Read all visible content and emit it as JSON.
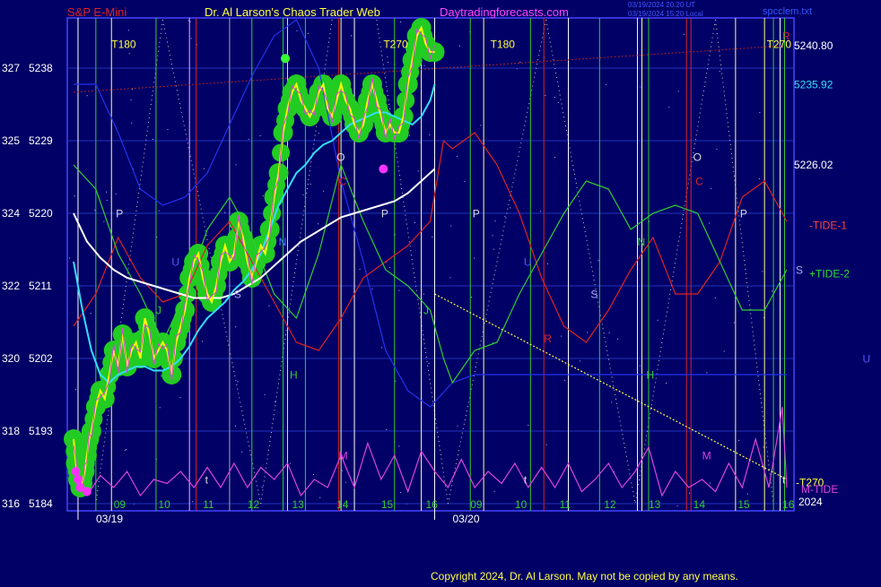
{
  "header": {
    "symbol": "S&P E-Mini",
    "site_title": "Dr. Al Larson's Chaos Trader Web",
    "site_url": "Daytradingforecasts.com",
    "stamp_line1": "03/19/2024 20:20 UT",
    "stamp_line2": "03/19/2024 15:20 Local",
    "file_name": "spcclem.txt"
  },
  "footer": {
    "copyright": "Copyright 2024, Dr. Al Larson. May not be copied by any means."
  },
  "colors": {
    "background": "#000066",
    "plot_border": "#4444ff",
    "price_line": "#ffff00",
    "price_halo": "#22cc22",
    "ema_fast": "#33ddff",
    "ema_slow": "#ffffff",
    "tide1": "#dd2222",
    "tide2": "#33cc33",
    "mtide": "#dd44dd",
    "blue_line": "#2233ee",
    "t270_line": "#ffff44",
    "red_trend": "#aa2222"
  },
  "chart_data": {
    "type": "line",
    "title": "S&P E-Mini",
    "xlabel": "",
    "ylabel": "",
    "x_range": [
      0,
      16
    ],
    "ylim": [
      5184,
      5244
    ],
    "grid": false,
    "dates": [
      "03/19",
      "03/20"
    ],
    "x_tick_labels": [
      "09",
      "10",
      "11",
      "12",
      "13",
      "14",
      "15",
      "16",
      "09",
      "10",
      "11",
      "12",
      "13",
      "14",
      "15",
      "16"
    ],
    "x_tick_positions": [
      0.9,
      1.9,
      2.9,
      3.9,
      4.9,
      5.9,
      6.9,
      7.9,
      8.9,
      9.9,
      10.9,
      11.9,
      12.9,
      13.9,
      14.9,
      15.9
    ],
    "y_axis_labels": [
      {
        "deg": "316",
        "price": "5184",
        "value": 5184
      },
      {
        "deg": "318",
        "price": "5193",
        "value": 5193
      },
      {
        "deg": "320",
        "price": "5202",
        "value": 5202
      },
      {
        "deg": "322",
        "price": "5211",
        "value": 5211
      },
      {
        "deg": "324",
        "price": "5220",
        "value": 5220
      },
      {
        "deg": "325",
        "price": "5229",
        "value": 5229
      },
      {
        "deg": "327",
        "price": "5238",
        "value": 5238
      }
    ],
    "right_labels": [
      {
        "text": "5240.80",
        "value": 5240.8,
        "color": "#ffffff"
      },
      {
        "text": "5235.92",
        "value": 5235.92,
        "color": "#33ddff"
      },
      {
        "text": "5226.02",
        "value": 5226.02,
        "color": "#ffffff"
      },
      {
        "text": "-TIDE-1",
        "value": 5218.5,
        "color": "#ff4444"
      },
      {
        "text": "+TIDE-2",
        "value": 5212.5,
        "color": "#33dd33"
      },
      {
        "text": "-T270",
        "value": 5186.6,
        "color": "#ffff44"
      },
      {
        "text": "M-TIDE",
        "value": 5185.8,
        "color": "#dd44dd"
      },
      {
        "text": "2024",
        "value": 5184.2,
        "color": "#ffffff"
      }
    ],
    "series": [
      {
        "name": "",
        "color": "#ffff00",
        "x": [
          0,
          0.05,
          0.1,
          0.15,
          0.2,
          0.25,
          0.3,
          0.35,
          0.4,
          0.5,
          0.6,
          0.7,
          0.8,
          0.9,
          1.0,
          1.1,
          1.2,
          1.3,
          1.4,
          1.5,
          1.6,
          1.7,
          1.8,
          1.9,
          2.0,
          2.1,
          2.2,
          2.3,
          2.4,
          2.5,
          2.6,
          2.7,
          2.8,
          2.9,
          3.0,
          3.1,
          3.2,
          3.3,
          3.4,
          3.5,
          3.6,
          3.7,
          3.8,
          3.9,
          4.0,
          4.1,
          4.2,
          4.3,
          4.4,
          4.5,
          4.6,
          4.7,
          4.8,
          4.9,
          5.0,
          5.1,
          5.2,
          5.3,
          5.4,
          5.5,
          5.6,
          5.7,
          5.8,
          5.9,
          6.0,
          6.1,
          6.2,
          6.3,
          6.4,
          6.5,
          6.6,
          6.7,
          6.8,
          6.9,
          7.0,
          7.1,
          7.2,
          7.3,
          7.4,
          7.5,
          7.6,
          7.7,
          7.8,
          7.9,
          8.0,
          8.1
        ],
        "values": [
          5192,
          5189,
          5187,
          5186,
          5186.5,
          5188,
          5190,
          5192,
          5193,
          5196,
          5198,
          5197,
          5200,
          5203,
          5201,
          5205,
          5201,
          5203,
          5204,
          5202,
          5207,
          5205,
          5202,
          5203,
          5204,
          5203,
          5200,
          5204,
          5206,
          5208,
          5212,
          5214,
          5215,
          5212,
          5210,
          5209,
          5211,
          5214,
          5216,
          5214,
          5215,
          5219,
          5217,
          5214,
          5212,
          5214,
          5216,
          5215,
          5218,
          5222,
          5225,
          5230,
          5233,
          5235,
          5236,
          5234,
          5233,
          5232,
          5233,
          5235,
          5236,
          5233,
          5232,
          5234,
          5236,
          5234,
          5233,
          5231,
          5230,
          5231,
          5234,
          5236,
          5234,
          5232,
          5230,
          5231,
          5230,
          5230,
          5232,
          5236,
          5239,
          5242,
          5243,
          5241,
          5240,
          5240
        ]
      },
      {
        "name": "",
        "color": "#33ddff",
        "x": [
          0,
          0.2,
          0.4,
          0.6,
          0.8,
          1.0,
          1.2,
          1.4,
          1.6,
          1.8,
          2.0,
          2.2,
          2.4,
          2.6,
          2.8,
          3.0,
          3.2,
          3.4,
          3.6,
          3.8,
          4.0,
          4.2,
          4.4,
          4.6,
          4.8,
          5.0,
          5.2,
          5.4,
          5.6,
          5.8,
          6.0,
          6.2,
          6.4,
          6.6,
          6.8,
          7.0,
          7.2,
          7.4,
          7.6,
          7.8,
          8.0,
          8.1
        ],
        "values": [
          5214,
          5208,
          5203,
          5200,
          5199,
          5200,
          5200.5,
          5201,
          5201,
          5200.5,
          5200.5,
          5201,
          5202,
          5203.5,
          5205.5,
          5207,
          5208,
          5209,
          5210.5,
          5211.5,
          5213,
          5215,
          5218,
          5221,
          5223,
          5225,
          5226,
          5227.5,
          5228.5,
          5229,
          5230,
          5231,
          5231.5,
          5232,
          5232.5,
          5232.5,
          5232,
          5231.5,
          5231,
          5232,
          5234,
          5236
        ]
      },
      {
        "name": "",
        "color": "#ffffff",
        "x": [
          0,
          0.3,
          0.6,
          0.9,
          1.2,
          1.5,
          1.8,
          2.1,
          2.4,
          2.7,
          3.0,
          3.3,
          3.6,
          3.9,
          4.2,
          4.5,
          4.8,
          5.1,
          5.4,
          5.7,
          6.0,
          6.3,
          6.6,
          6.9,
          7.2,
          7.5,
          7.8,
          8.1
        ],
        "values": [
          5220,
          5216.5,
          5214.5,
          5213,
          5212,
          5211.5,
          5211,
          5210.5,
          5210,
          5209.5,
          5209.5,
          5209.5,
          5210,
          5211,
          5212,
          5213.5,
          5215,
          5216.5,
          5217.5,
          5218.5,
          5219.5,
          5220,
          5220.5,
          5221,
          5221.5,
          5222.5,
          5224,
          5225.5
        ]
      },
      {
        "name": "-TIDE-1",
        "color": "#dd2222",
        "x": [
          0,
          0.5,
          1.0,
          1.5,
          2.0,
          2.5,
          3.0,
          3.5,
          4.0,
          4.5,
          5.0,
          5.5,
          6.0,
          6.5,
          7.0,
          7.5,
          8.0,
          8.3,
          8.5,
          9.0,
          9.5,
          10.0,
          10.5,
          11.0,
          11.5,
          12.0,
          12.5,
          13.0,
          13.5,
          14.0,
          14.5,
          15.0,
          15.5,
          16.0
        ],
        "values": [
          5206,
          5210,
          5217,
          5212,
          5209,
          5210,
          5216,
          5219,
          5214,
          5209,
          5204,
          5203,
          5207,
          5212,
          5214,
          5216,
          5219,
          5229,
          5228,
          5230,
          5226,
          5220,
          5212,
          5206,
          5204,
          5208,
          5213,
          5217,
          5210,
          5210,
          5214,
          5222,
          5224,
          5219
        ]
      },
      {
        "name": "+TIDE-2",
        "color": "#33cc33",
        "x": [
          0,
          0.5,
          1.0,
          1.5,
          2.0,
          2.5,
          3.0,
          3.5,
          4.0,
          4.5,
          5.0,
          5.5,
          6.0,
          6.5,
          7.0,
          7.5,
          8.0,
          8.3,
          8.5,
          9.0,
          9.5,
          10.0,
          10.5,
          11.0,
          11.5,
          12.0,
          12.5,
          13.0,
          13.5,
          14.0,
          14.5,
          15.0,
          15.5,
          16.0
        ],
        "values": [
          5226,
          5223,
          5215,
          5210,
          5204,
          5210,
          5218,
          5222,
          5217,
          5210,
          5207,
          5215,
          5226,
          5219,
          5213,
          5211,
          5208,
          5202,
          5199,
          5203,
          5204,
          5210,
          5215,
          5220,
          5224,
          5223,
          5218,
          5220,
          5221,
          5220,
          5214,
          5208,
          5208,
          5213
        ]
      },
      {
        "name": "",
        "color": "#2233ee",
        "x": [
          0,
          0.5,
          1.0,
          1.5,
          2.0,
          2.5,
          3.0,
          3.5,
          4.0,
          4.5,
          5.0,
          5.5,
          6.0,
          6.5,
          7.0,
          7.5,
          8.0,
          8.5,
          9.0,
          9.5,
          10.0,
          10.5,
          11.0,
          11.5,
          12.0,
          12.5,
          13.0,
          13.5,
          14.0,
          14.5,
          15.0,
          15.5,
          16.0
        ],
        "values": [
          5236,
          5236,
          5230,
          5223,
          5221,
          5222,
          5225,
          5231,
          5237,
          5242,
          5244,
          5238,
          5224,
          5214,
          5203,
          5198,
          5196,
          5199,
          5200,
          5200,
          5200,
          5200,
          5200,
          5200,
          5200,
          5200,
          5200,
          5200,
          5200,
          5200,
          5200,
          5200,
          5200
        ]
      },
      {
        "name": "M-TIDE",
        "color": "#dd44dd",
        "x": [
          0,
          0.3,
          0.6,
          0.9,
          1.2,
          1.5,
          1.8,
          2.1,
          2.4,
          2.7,
          3.0,
          3.3,
          3.6,
          3.9,
          4.2,
          4.5,
          4.8,
          5.1,
          5.4,
          5.7,
          6.0,
          6.3,
          6.6,
          6.9,
          7.2,
          7.5,
          7.8,
          8.1,
          8.4,
          8.7,
          9.0,
          9.3,
          9.6,
          9.9,
          10.2,
          10.5,
          10.8,
          11.1,
          11.4,
          11.7,
          12.0,
          12.3,
          12.6,
          12.9,
          13.2,
          13.5,
          13.8,
          14.1,
          14.4,
          14.7,
          15.0,
          15.3,
          15.6,
          15.9,
          16.0
        ],
        "values": [
          5187,
          5185,
          5187.5,
          5186,
          5188,
          5185,
          5187,
          5186.5,
          5188,
          5186,
          5188.5,
          5186,
          5189,
          5186,
          5188.5,
          5187,
          5189,
          5185,
          5187,
          5186,
          5190,
          5186,
          5191.5,
          5187,
          5190,
          5185.5,
          5190.5,
          5188,
          5186,
          5189.5,
          5186,
          5188,
          5186.5,
          5189,
          5186,
          5188.5,
          5186,
          5189,
          5185.5,
          5187,
          5189,
          5186,
          5188,
          5191,
          5185,
          5188,
          5186,
          5187,
          5185.5,
          5189,
          5186,
          5192,
          5186,
          5196,
          5186
        ]
      },
      {
        "name": "-T270",
        "color": "#ffff44",
        "x": [
          8.1,
          16.0
        ],
        "values": [
          5210,
          5187
        ]
      }
    ]
  },
  "vertical_lines": [
    {
      "x": 0.1,
      "color": "#ffffff"
    },
    {
      "x": 0.5,
      "color": "#33cc33"
    },
    {
      "x": 0.85,
      "color": "#ffff88"
    },
    {
      "x": 1.85,
      "color": "#33cc33"
    },
    {
      "x": 2.6,
      "color": "#ffaaff"
    },
    {
      "x": 2.75,
      "color": "#dd2222"
    },
    {
      "x": 3.5,
      "color": "#aaaaaa"
    },
    {
      "x": 4.0,
      "color": "#33cc33"
    },
    {
      "x": 4.7,
      "color": "#33cc33"
    },
    {
      "x": 4.8,
      "color": "#aaffaa"
    },
    {
      "x": 5.2,
      "color": "#33cc33"
    },
    {
      "x": 5.95,
      "color": "#dd2222"
    },
    {
      "x": 6.0,
      "color": "#ffff88"
    },
    {
      "x": 6.3,
      "color": "#ffffff"
    },
    {
      "x": 7.2,
      "color": "#33cc33"
    },
    {
      "x": 7.8,
      "color": "#ffff88"
    },
    {
      "x": 8.1,
      "color": "#ffffff"
    },
    {
      "x": 8.9,
      "color": "#33cc33"
    },
    {
      "x": 9.2,
      "color": "#ffff88"
    },
    {
      "x": 10.25,
      "color": "#33cc33"
    },
    {
      "x": 10.55,
      "color": "#dd2222"
    },
    {
      "x": 11.1,
      "color": "#ffffff"
    },
    {
      "x": 11.8,
      "color": "#33cc33"
    },
    {
      "x": 12.65,
      "color": "#ffffff"
    },
    {
      "x": 12.75,
      "color": "#ffff88"
    },
    {
      "x": 12.9,
      "color": "#33cc33"
    },
    {
      "x": 13.75,
      "color": "#dd2222"
    },
    {
      "x": 13.85,
      "color": "#dd2222"
    },
    {
      "x": 14.85,
      "color": "#ffff88"
    },
    {
      "x": 15.5,
      "color": "#ffff88"
    },
    {
      "x": 15.7,
      "color": "#33cc33"
    },
    {
      "x": 15.85,
      "color": "#ffffff"
    },
    {
      "x": 15.95,
      "color": "#33cc33"
    }
  ],
  "dotted_diagonals": [
    {
      "x1": 2.0,
      "y1": 5244,
      "x2": 0.5,
      "y2": 5184
    },
    {
      "x1": 2.0,
      "y1": 5244,
      "x2": 4.2,
      "y2": 5184
    },
    {
      "x1": 5.8,
      "y1": 5244,
      "x2": 4.2,
      "y2": 5184
    },
    {
      "x1": 6.8,
      "y1": 5244,
      "x2": 8.4,
      "y2": 5184
    },
    {
      "x1": 10.6,
      "y1": 5244,
      "x2": 8.4,
      "y2": 5184
    },
    {
      "x1": 10.6,
      "y1": 5244,
      "x2": 12.6,
      "y2": 5184
    },
    {
      "x1": 14.4,
      "y1": 5244,
      "x2": 12.6,
      "y2": 5184
    },
    {
      "x1": 14.4,
      "y1": 5244,
      "x2": 15.7,
      "y2": 5184
    }
  ],
  "red_trend": [
    {
      "x": 0,
      "v": 5235
    },
    {
      "x": 16,
      "v": 5240.8
    }
  ],
  "letter_annotations": [
    {
      "text": "T180",
      "x": 0.85,
      "v": 5240.5,
      "color": "#ffff44"
    },
    {
      "text": "T270",
      "x": 6.95,
      "v": 5240.5,
      "color": "#ffff44"
    },
    {
      "text": "T180",
      "x": 9.35,
      "v": 5240.5,
      "color": "#ffff44"
    },
    {
      "text": "T270",
      "x": 15.55,
      "v": 5240.5,
      "color": "#ffff44"
    },
    {
      "text": "P",
      "x": 0.95,
      "v": 5219.5,
      "color": "#dddddd"
    },
    {
      "text": "U",
      "x": 2.2,
      "v": 5213.5,
      "color": "#5555ff"
    },
    {
      "text": "J",
      "x": 1.85,
      "v": 5207.5,
      "color": "#33cc33"
    },
    {
      "text": "N",
      "x": 4.6,
      "v": 5216,
      "color": "#4488ff"
    },
    {
      "text": "S",
      "x": 3.6,
      "v": 5209.5,
      "color": "#aaaaff"
    },
    {
      "text": "H",
      "x": 4.85,
      "v": 5199.5,
      "color": "#33cc33"
    },
    {
      "text": "O",
      "x": 5.9,
      "v": 5226.5,
      "color": "#dddddd"
    },
    {
      "text": "C",
      "x": 5.95,
      "v": 5223.5,
      "color": "#dd2222"
    },
    {
      "text": "M",
      "x": 5.95,
      "v": 5189.5,
      "color": "#dd44dd"
    },
    {
      "text": "t",
      "x": 2.95,
      "v": 5186.5,
      "color": "#dddddd"
    },
    {
      "text": "P",
      "x": 6.9,
      "v": 5219.5,
      "color": "#dddddd"
    },
    {
      "text": "J",
      "x": 7.85,
      "v": 5207.5,
      "color": "#33cc33"
    },
    {
      "text": "P",
      "x": 8.95,
      "v": 5219.5,
      "color": "#dddddd"
    },
    {
      "text": "U",
      "x": 10.1,
      "v": 5213.5,
      "color": "#5555ff"
    },
    {
      "text": "R",
      "x": 10.55,
      "v": 5204,
      "color": "#dd2222"
    },
    {
      "text": "S",
      "x": 11.6,
      "v": 5209.5,
      "color": "#aaaaff"
    },
    {
      "text": "N",
      "x": 12.65,
      "v": 5216,
      "color": "#33cc33"
    },
    {
      "text": "H",
      "x": 12.85,
      "v": 5199.5,
      "color": "#33cc33"
    },
    {
      "text": "O",
      "x": 13.9,
      "v": 5226.5,
      "color": "#dddddd"
    },
    {
      "text": "C",
      "x": 13.95,
      "v": 5223.5,
      "color": "#dd2222"
    },
    {
      "text": "M",
      "x": 14.1,
      "v": 5189.5,
      "color": "#dd44dd"
    },
    {
      "text": "P",
      "x": 14.95,
      "v": 5219.5,
      "color": "#dddddd"
    },
    {
      "text": "t",
      "x": 10.1,
      "v": 5186.5,
      "color": "#dddddd"
    },
    {
      "text": "t",
      "x": 15.9,
      "v": 5186.5,
      "color": "#dddddd"
    },
    {
      "text": "R",
      "x": 15.9,
      "v": 5241.5,
      "color": "#dd2222"
    },
    {
      "text": "U",
      "x": 17.7,
      "v": 5201.5,
      "color": "#5555ff"
    },
    {
      "text": "S",
      "x": 16.2,
      "v": 5212.5,
      "color": "#aaaaff"
    }
  ],
  "magenta_dots": [
    {
      "x": 0.05,
      "v": 5188
    },
    {
      "x": 0.1,
      "v": 5187
    },
    {
      "x": 0.15,
      "v": 5186
    },
    {
      "x": 0.3,
      "v": 5185.5
    },
    {
      "x": 4.75,
      "v": 5239.2
    },
    {
      "x": 6.95,
      "v": 5225.5
    }
  ]
}
